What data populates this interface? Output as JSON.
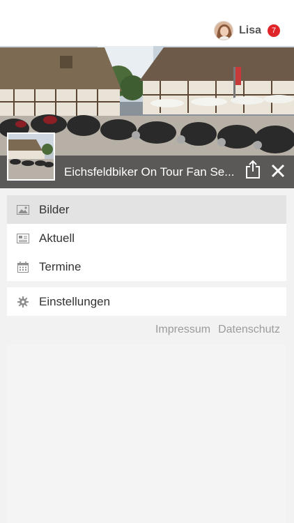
{
  "header": {
    "user_name": "Lisa",
    "notification_count": "7"
  },
  "page": {
    "title": "Eichsfeldbiker On Tour Fan Se..."
  },
  "menu": {
    "items": [
      {
        "label": "Bilder",
        "icon": "image-icon",
        "active": true
      },
      {
        "label": "Aktuell",
        "icon": "newspaper-icon",
        "active": false
      },
      {
        "label": "Termine",
        "icon": "calendar-icon",
        "active": false
      }
    ],
    "settings_label": "Einstellungen"
  },
  "footer": {
    "impressum": "Impressum",
    "datenschutz": "Datenschutz"
  },
  "colors": {
    "badge": "#e0252a",
    "title_bar": "#464646"
  }
}
